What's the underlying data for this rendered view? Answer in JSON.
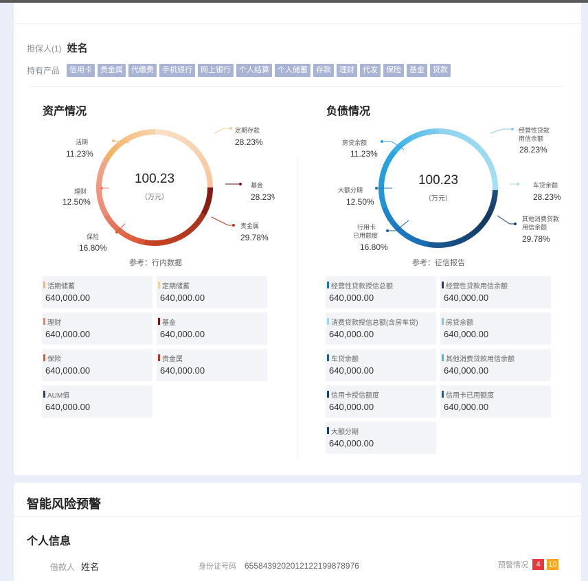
{
  "guarantor": {
    "label": "担保人(1)",
    "name": "姓名"
  },
  "products": {
    "label": "持有产品",
    "items": [
      "信用卡",
      "贵金属",
      "代缴费",
      "手机银行",
      "网上银行",
      "个人结算",
      "个人储蓄",
      "存款",
      "理财",
      "代发",
      "保险",
      "基金",
      "贷款"
    ]
  },
  "assets": {
    "title": "资产情况",
    "center_value": "100.23",
    "center_unit": "（万元）",
    "reference": "参考：行内数据",
    "labels": [
      {
        "name": "活期",
        "pct": "11.23%"
      },
      {
        "name": "定期存款",
        "pct": "28.23%"
      },
      {
        "name": "理财",
        "pct": "12.50%"
      },
      {
        "name": "基金",
        "pct": "28.23%"
      },
      {
        "name": "保险",
        "pct": "16.80%"
      },
      {
        "name": "贵金属",
        "pct": "29.78%"
      }
    ],
    "boxes": [
      {
        "name": "活期储蓄",
        "value": "640,000.00",
        "color": "#f5b971"
      },
      {
        "name": "定期储蓄",
        "value": "640,000.00",
        "color": "#f8cfa4"
      },
      {
        "name": "理财",
        "value": "640,000.00",
        "color": "#e9826f"
      },
      {
        "name": "基金",
        "value": "640,000.00",
        "color": "#6e1616"
      },
      {
        "name": "保险",
        "value": "640,000.00",
        "color": "#d85a3a"
      },
      {
        "name": "贵金属",
        "value": "640,000.00",
        "color": "#b83a22"
      },
      {
        "name": "AUM值",
        "value": "640,000.00",
        "color": "#27426e"
      }
    ]
  },
  "liabilities": {
    "title": "负债情况",
    "center_value": "100.23",
    "center_unit": "（万元）",
    "reference": "参考：征信报告",
    "labels": [
      {
        "name": "房贷余额",
        "pct": "11.23%"
      },
      {
        "name": "经营性贷款用信余额",
        "line1": "经营性贷款",
        "line2": "用信余额",
        "pct": "28.23%"
      },
      {
        "name": "大额分期",
        "pct": "12.50%"
      },
      {
        "name": "车贷余额",
        "pct": "28.23%"
      },
      {
        "name": "行用卡已用额度",
        "line1": "行用卡",
        "line2": "已用额度",
        "pct": "16.80%"
      },
      {
        "name": "其他消费贷款用信余额",
        "line1": "其他消费贷款",
        "line2": "用信余额",
        "pct": "29.78%"
      }
    ],
    "boxes": [
      {
        "name": "经营性贷款授信总额",
        "value": "640,000.00",
        "color": "#1f73b7"
      },
      {
        "name": "经营性贷款用信余额",
        "value": "640,000.00",
        "color": "#1a3f6e"
      },
      {
        "name": "消费贷款授信总额(含房车贷)",
        "value": "640,000.00",
        "color": "#9fd8ee"
      },
      {
        "name": "房贷余额",
        "value": "640,000.00",
        "color": "#7fc6e6"
      },
      {
        "name": "车贷余额",
        "value": "640,000.00",
        "color": "#1e5f9a"
      },
      {
        "name": "其他消费贷款用信余额",
        "value": "640,000.00",
        "color": "#46b9c8"
      },
      {
        "name": "信用卡授信额度",
        "value": "640,000.00",
        "color": "#1a3f6e"
      },
      {
        "name": "信用卡已用额度",
        "value": "640,000.00",
        "color": "#1e5f9a"
      },
      {
        "name": "大额分期",
        "value": "640,000.00",
        "color": "#1a3f6e"
      }
    ]
  },
  "warning": {
    "title": "智能风险预警",
    "personal_title": "个人信息",
    "borrower_label": "借款人",
    "borrower_name": "姓名",
    "id_label": "身份证号码",
    "id_value": "6558439202012122199878976",
    "alert_label": "预警情况",
    "alert_red": "4",
    "alert_orange": "10",
    "alert_red_color": "#e8383d",
    "alert_orange_color": "#f5a623"
  }
}
